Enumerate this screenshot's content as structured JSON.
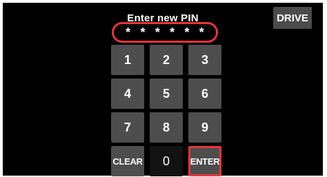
{
  "title": "Enter new PIN",
  "drive_button": "DRIVE",
  "pin_field": {
    "masked_chars": [
      "*",
      "*",
      "*",
      "*",
      "*",
      "*"
    ],
    "highlight_color": "#e8363a"
  },
  "keypad": {
    "keys": [
      {
        "label": "1",
        "name": "key-1"
      },
      {
        "label": "2",
        "name": "key-2"
      },
      {
        "label": "3",
        "name": "key-3"
      },
      {
        "label": "4",
        "name": "key-4"
      },
      {
        "label": "5",
        "name": "key-5"
      },
      {
        "label": "6",
        "name": "key-6"
      },
      {
        "label": "7",
        "name": "key-7"
      },
      {
        "label": "8",
        "name": "key-8"
      },
      {
        "label": "9",
        "name": "key-9"
      },
      {
        "label": "CLEAR",
        "name": "clear-button"
      },
      {
        "label": "0",
        "name": "key-0"
      },
      {
        "label": "ENTER",
        "name": "enter-button"
      }
    ]
  },
  "colors": {
    "background": "#000000",
    "key": "#4d4d4d",
    "highlight": "#e8363a"
  }
}
